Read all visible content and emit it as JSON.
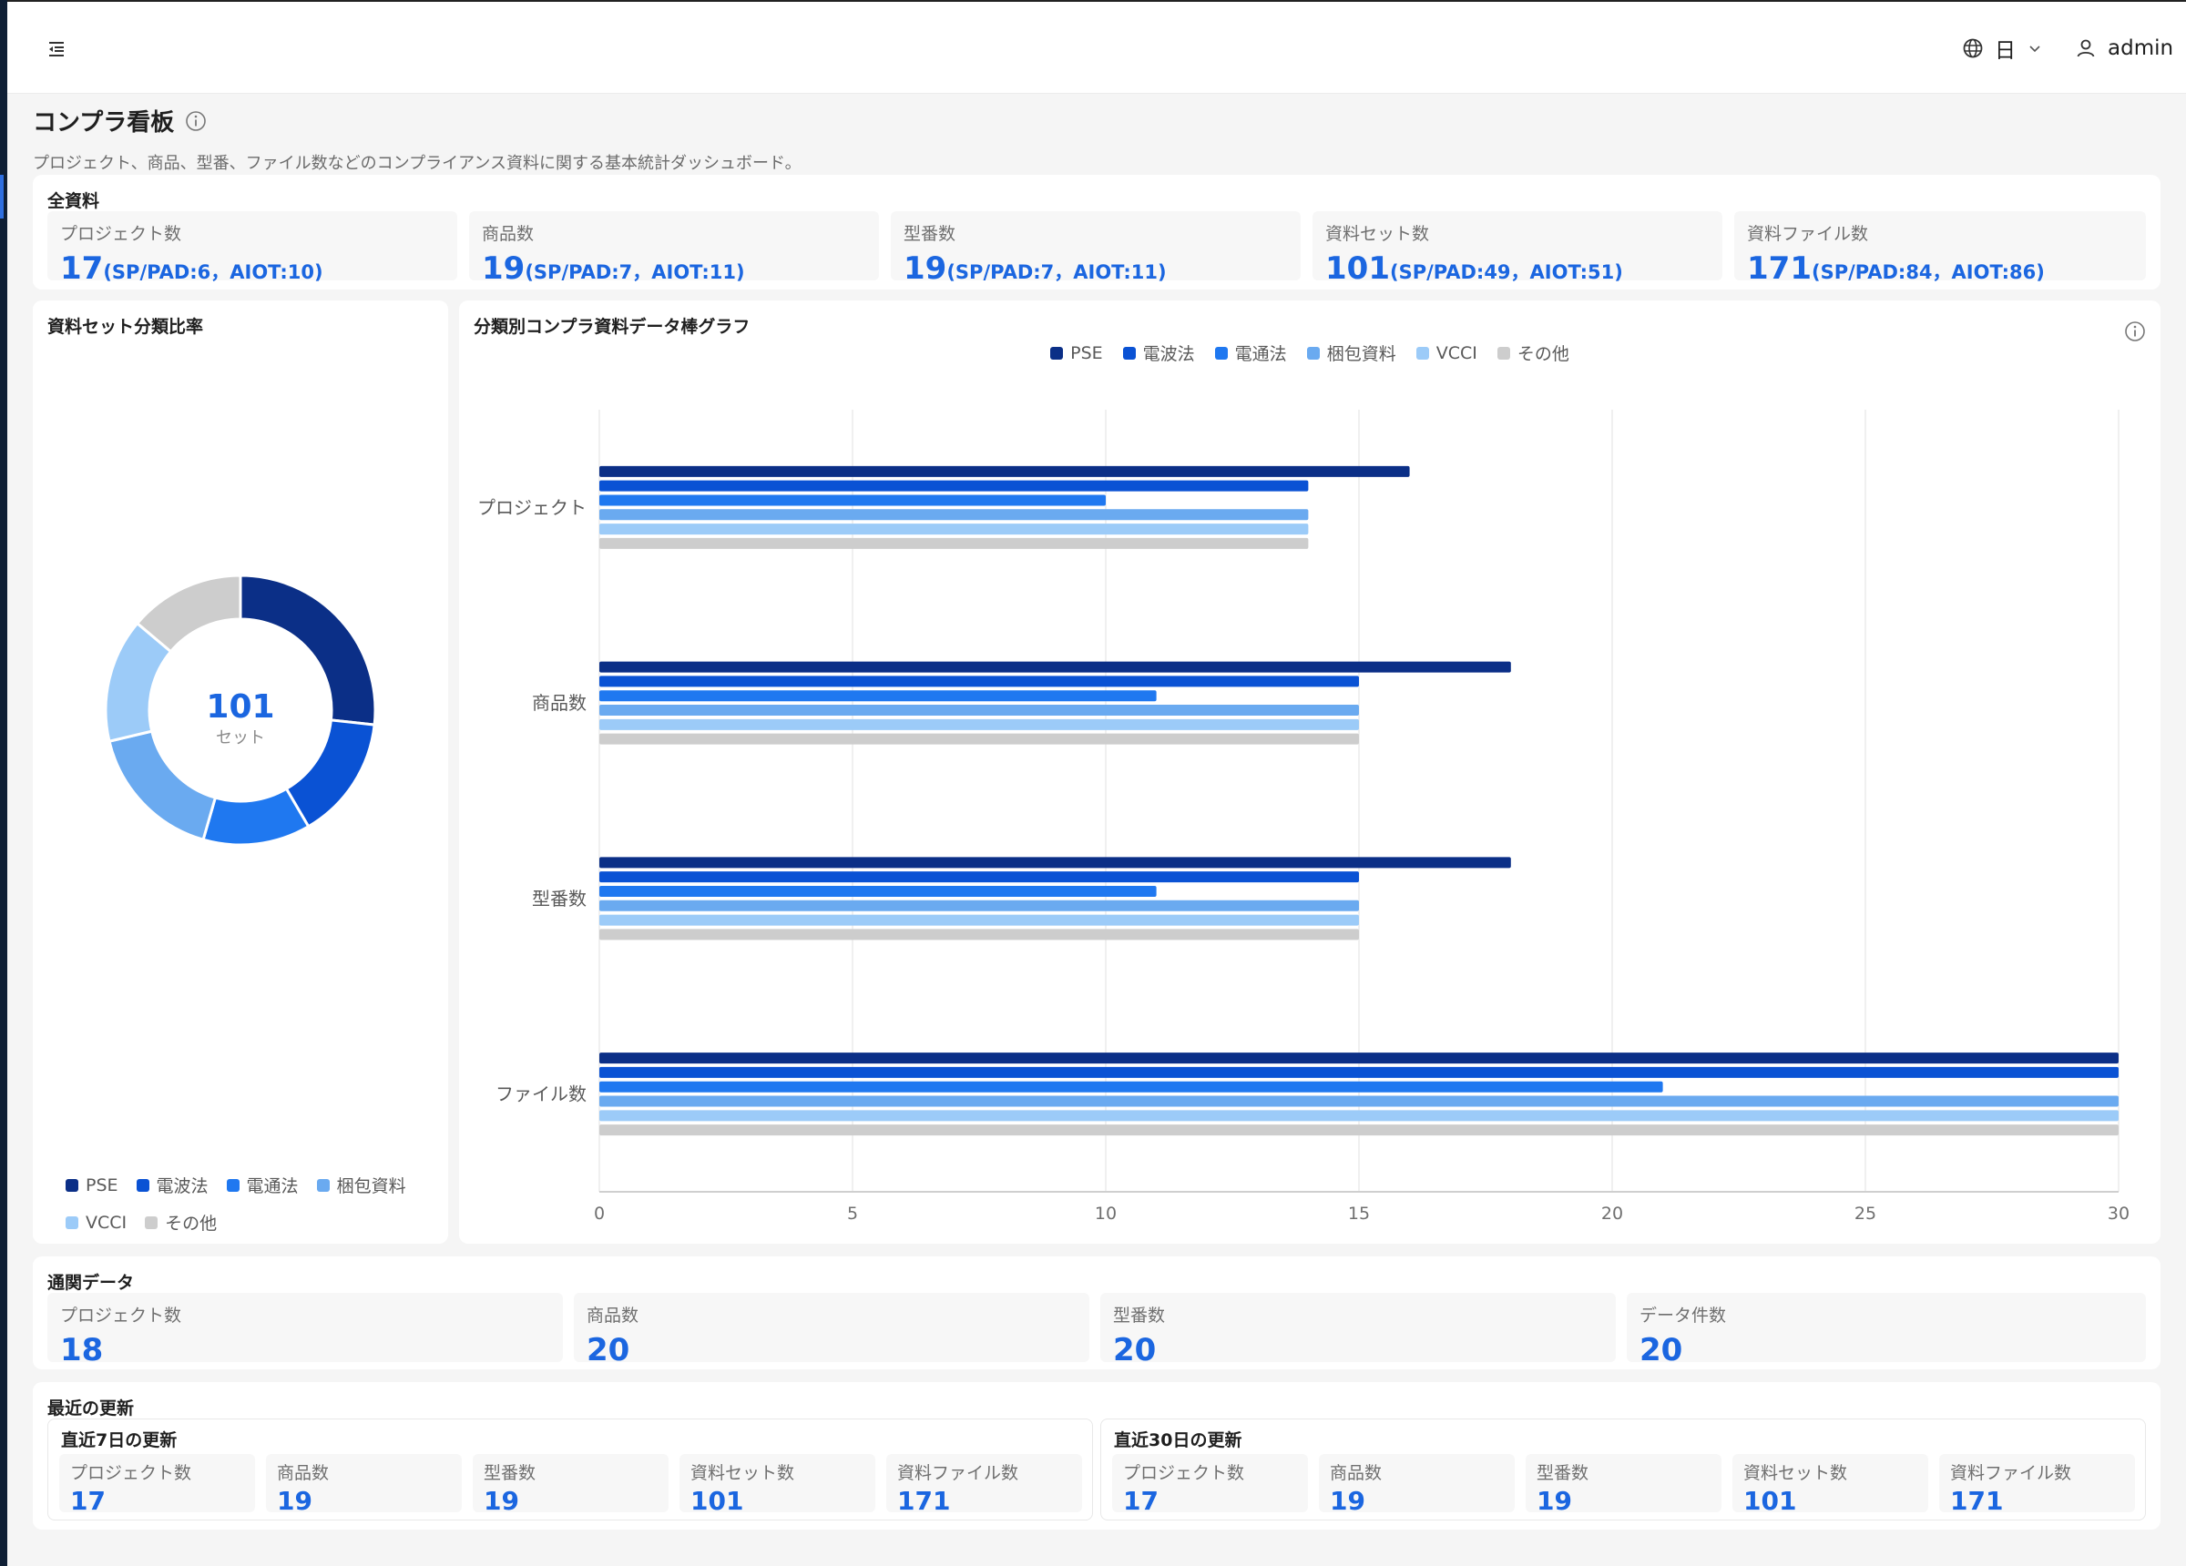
{
  "header": {
    "lang_label": "日",
    "user_name": "admin"
  },
  "page": {
    "title": "コンプラ看板",
    "description": "プロジェクト、商品、型番、ファイル数などのコンプライアンス資料に関する基本統計ダッシュボード。"
  },
  "all_materials": {
    "title": "全資料",
    "stats": [
      {
        "label": "プロジェクト数",
        "value": "17",
        "detail": "(SP/PAD:6，AIOT:10)"
      },
      {
        "label": "商品数",
        "value": "19",
        "detail": "(SP/PAD:7，AIOT:11)"
      },
      {
        "label": "型番数",
        "value": "19",
        "detail": "(SP/PAD:7，AIOT:11)"
      },
      {
        "label": "資料セット数",
        "value": "101",
        "detail": "(SP/PAD:49，AIOT:51)"
      },
      {
        "label": "資料ファイル数",
        "value": "171",
        "detail": "(SP/PAD:84，AIOT:86)"
      }
    ]
  },
  "colors": {
    "PSE": "#0b2f87",
    "電波法": "#0a52d4",
    "電通法": "#1f78f0",
    "梱包資料": "#6aaaf0",
    "VCCI": "#9ccbf8",
    "その他": "#cdcdcd"
  },
  "donut": {
    "title": "資料セット分類比率",
    "center_value": "101",
    "center_unit": "セット",
    "legend": [
      "PSE",
      "電波法",
      "電通法",
      "梱包資料",
      "VCCI",
      "その他"
    ]
  },
  "bar_chart": {
    "title": "分類別コンプラ資料データ棒グラフ"
  },
  "chart_data": [
    {
      "type": "pie",
      "title": "資料セット分類比率",
      "labels": [
        "PSE",
        "電波法",
        "電通法",
        "梱包資料",
        "VCCI",
        "その他"
      ],
      "values": [
        27,
        15,
        13,
        17,
        15,
        14
      ],
      "legend": "bottom"
    },
    {
      "type": "bar",
      "orientation": "horizontal",
      "title": "分類別コンプラ資料データ棒グラフ",
      "categories": [
        "プロジェクト",
        "商品数",
        "型番数",
        "ファイル数"
      ],
      "series": [
        {
          "name": "PSE",
          "values": [
            16,
            18,
            18,
            30
          ]
        },
        {
          "name": "電波法",
          "values": [
            14,
            15,
            15,
            30
          ]
        },
        {
          "name": "電通法",
          "values": [
            10,
            11,
            11,
            21
          ]
        },
        {
          "name": "梱包資料",
          "values": [
            14,
            15,
            15,
            30
          ]
        },
        {
          "name": "VCCI",
          "values": [
            14,
            15,
            15,
            30
          ]
        },
        {
          "name": "その他",
          "values": [
            14,
            15,
            15,
            30
          ]
        }
      ],
      "xlim": [
        0,
        30
      ],
      "x_ticks": [
        "0",
        "5",
        "10",
        "15",
        "20",
        "25",
        "30"
      ],
      "grid": true,
      "legend": "top-center"
    }
  ],
  "customs": {
    "title": "通関データ",
    "stats": [
      {
        "label": "プロジェクト数",
        "value": "18"
      },
      {
        "label": "商品数",
        "value": "20"
      },
      {
        "label": "型番数",
        "value": "20"
      },
      {
        "label": "データ件数",
        "value": "20"
      }
    ]
  },
  "recent": {
    "title": "最近の更新",
    "groups": [
      {
        "title": "直近7日の更新",
        "stats": [
          {
            "label": "プロジェクト数",
            "value": "17"
          },
          {
            "label": "商品数",
            "value": "19"
          },
          {
            "label": "型番数",
            "value": "19"
          },
          {
            "label": "資料セット数",
            "value": "101"
          },
          {
            "label": "資料ファイル数",
            "value": "171"
          }
        ]
      },
      {
        "title": "直近30日の更新",
        "stats": [
          {
            "label": "プロジェクト数",
            "value": "17"
          },
          {
            "label": "商品数",
            "value": "19"
          },
          {
            "label": "型番数",
            "value": "19"
          },
          {
            "label": "資料セット数",
            "value": "101"
          },
          {
            "label": "資料ファイル数",
            "value": "171"
          }
        ]
      }
    ]
  }
}
